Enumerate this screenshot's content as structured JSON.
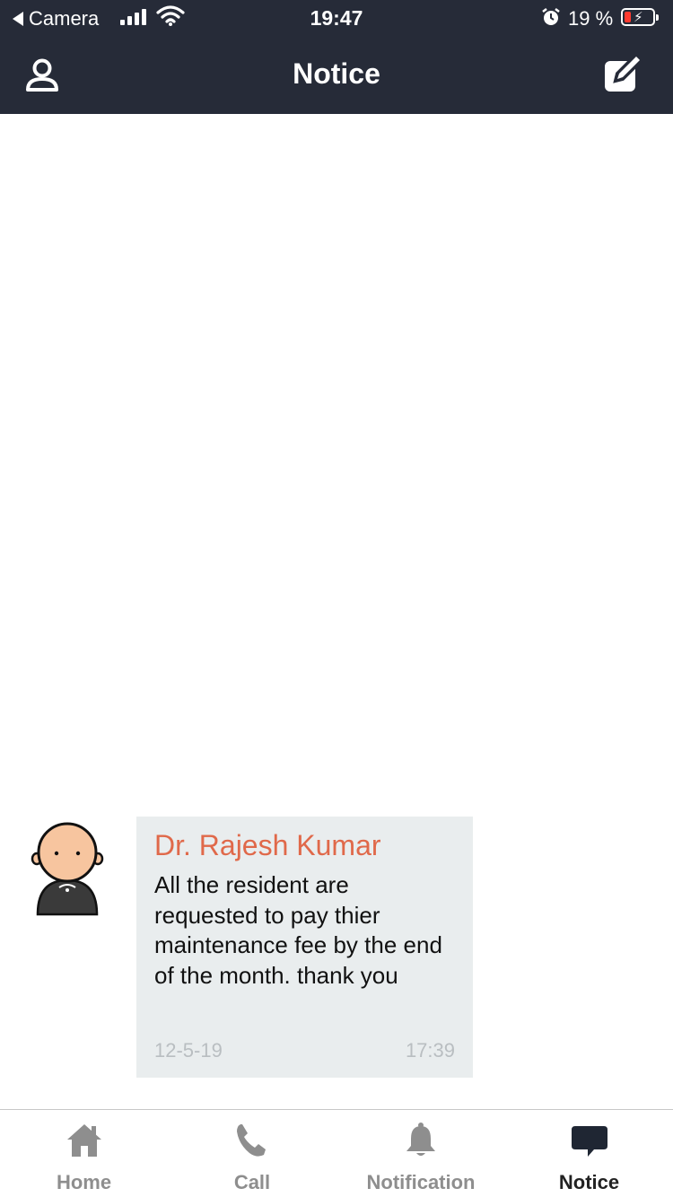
{
  "status_bar": {
    "back_label": "Camera",
    "time": "19:47",
    "battery_percent": "19 %"
  },
  "header": {
    "title": "Notice"
  },
  "notices": [
    {
      "sender": "Dr. Rajesh Kumar",
      "message": "All the resident are requested to pay thier maintenance fee by the end of the month. thank you",
      "date": "12-5-19",
      "time": "17:39"
    }
  ],
  "tabs": [
    {
      "label": "Home",
      "icon": "home-icon"
    },
    {
      "label": "Call",
      "icon": "phone-icon"
    },
    {
      "label": "Notification",
      "icon": "bell-icon"
    },
    {
      "label": "Notice",
      "icon": "chat-bubble-icon",
      "active": true
    }
  ],
  "colors": {
    "header_bg": "#262b38",
    "sender_name": "#e0694a",
    "bubble_bg": "#e9edee",
    "tab_inactive": "#8e8e8e",
    "tab_active": "#222222"
  }
}
